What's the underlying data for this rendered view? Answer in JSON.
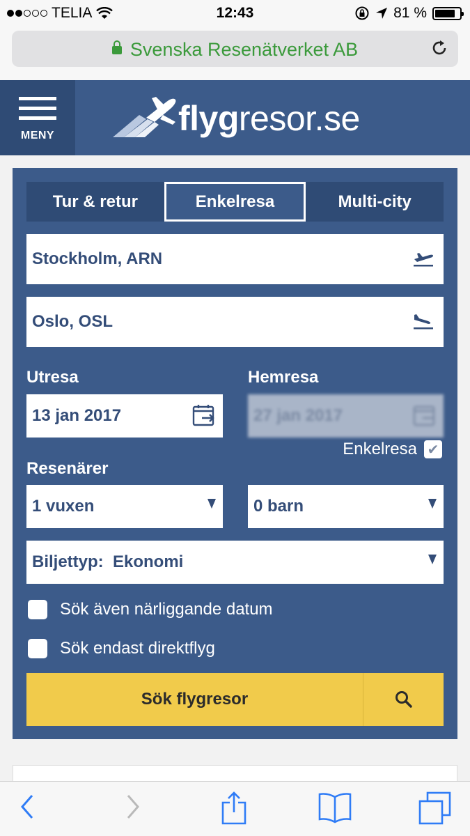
{
  "status_bar": {
    "carrier": "TELIA",
    "time": "12:43",
    "battery": "81 %",
    "battery_level": 0.81,
    "signal_bars": 2
  },
  "browser": {
    "site_title": "Svenska Resenätverket AB"
  },
  "header": {
    "menu_label": "MENY",
    "logo_bold": "flyg",
    "logo_rest": "resor.se"
  },
  "search": {
    "tabs": [
      {
        "label": "Tur & retur",
        "active": false
      },
      {
        "label": "Enkelresa",
        "active": true
      },
      {
        "label": "Multi-city",
        "active": false
      }
    ],
    "from": "Stockholm, ARN",
    "to": "Oslo, OSL",
    "outbound_label": "Utresa",
    "outbound_date": "13 jan 2017",
    "return_label": "Hemresa",
    "return_date": "27 jan 2017",
    "oneway_label": "Enkelresa",
    "travellers_label": "Resenärer",
    "adults": "1 vuxen",
    "children": "0 barn",
    "ticket_type": "Biljettyp:  Ekonomi",
    "nearby_dates_label": "Sök även närliggande datum",
    "direct_only_label": "Sök endast direktflyg",
    "submit_label": "Sök flygresor"
  },
  "colors": {
    "brand_blue": "#3c5b8a",
    "dark_blue": "#2f4b75",
    "button_yellow": "#f1cb4b",
    "secure_green": "#3b9a3b"
  },
  "icons": {
    "menu": "hamburger-icon",
    "departure": "plane-takeoff-icon",
    "arrival": "plane-landing-icon",
    "calendar": "calendar-icon",
    "search": "magnifier-icon",
    "back": "chevron-left-icon",
    "forward": "chevron-right-icon",
    "share": "share-icon",
    "bookmarks": "book-icon",
    "tabs": "tabs-icon"
  }
}
